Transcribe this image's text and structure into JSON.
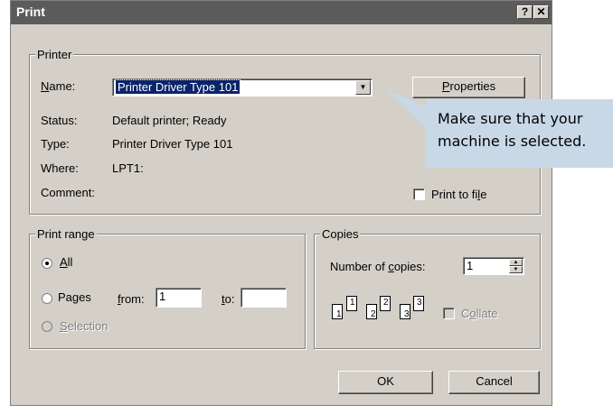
{
  "window": {
    "title": "Print",
    "help_btn": "?",
    "close_btn": "✕"
  },
  "printer": {
    "legend": "Printer",
    "name_label": "Name:",
    "name_value": "Printer Driver Type 101",
    "properties_label": "Properties",
    "status_label": "Status:",
    "status_value": "Default printer; Ready",
    "type_label": "Type:",
    "type_value": "Printer Driver Type 101",
    "where_label": "Where:",
    "where_value": "LPT1:",
    "comment_label": "Comment:",
    "print_to_file_label": "Print to file"
  },
  "print_range": {
    "legend": "Print range",
    "all_label": "All",
    "pages_label": "Pages",
    "from_label": "from:",
    "from_value": "1",
    "to_label": "to:",
    "to_value": "",
    "selection_label": "Selection",
    "selected": "all"
  },
  "copies": {
    "legend": "Copies",
    "number_label": "Number of copies:",
    "number_value": "1",
    "collate_label": "Collate",
    "collate_checked": false,
    "pages": [
      {
        "back": "1",
        "front": "1"
      },
      {
        "back": "2",
        "front": "2"
      },
      {
        "back": "3",
        "front": "3"
      }
    ]
  },
  "buttons": {
    "ok": "OK",
    "cancel": "Cancel"
  },
  "callout": {
    "line1": "Make sure that your",
    "line2": "machine is selected.",
    "color": "#c9d8e7"
  }
}
